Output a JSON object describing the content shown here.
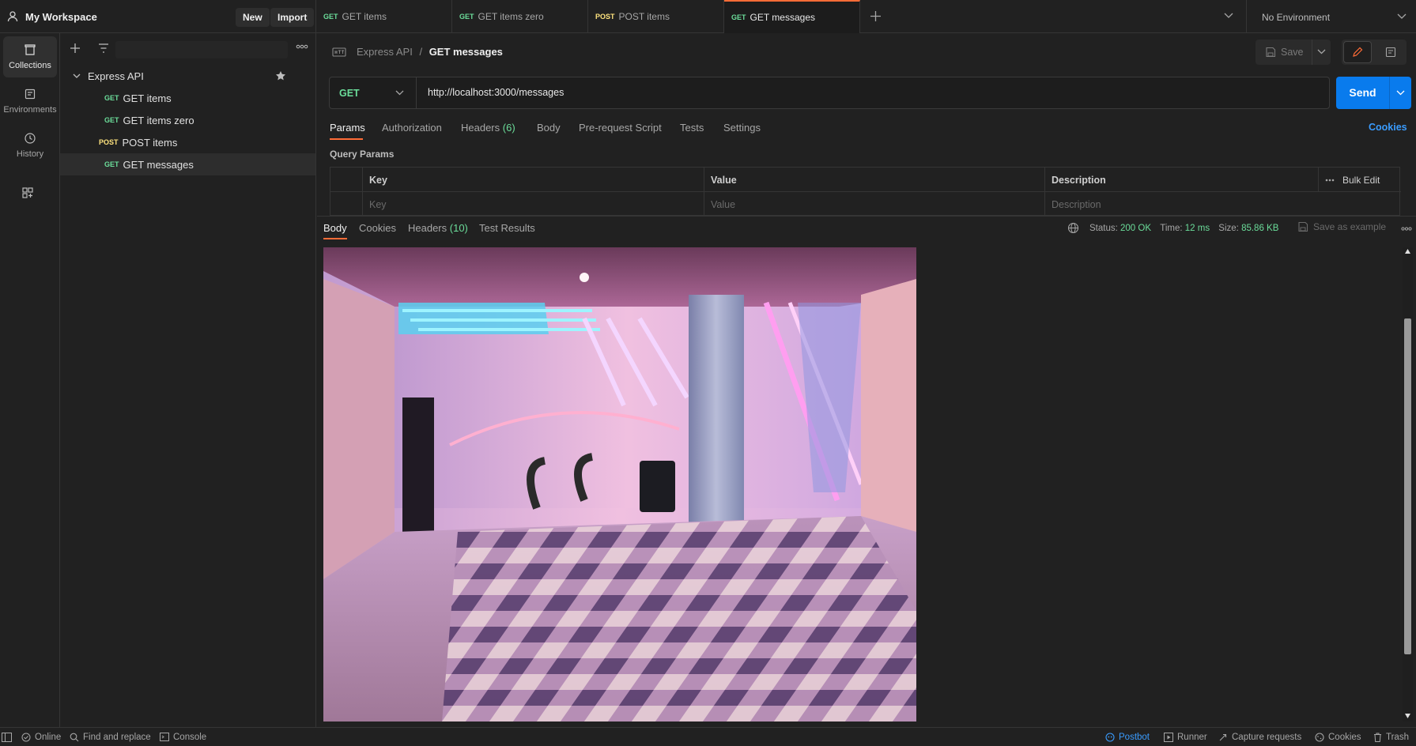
{
  "workspace": {
    "name": "My Workspace",
    "new_label": "New",
    "import_label": "Import"
  },
  "tabs": [
    {
      "method": "GET",
      "label": "GET items"
    },
    {
      "method": "GET",
      "label": "GET items zero"
    },
    {
      "method": "POST",
      "label": "POST items"
    },
    {
      "method": "GET",
      "label": "GET messages"
    }
  ],
  "environment": {
    "selected": "No Environment"
  },
  "rail": [
    {
      "label": "Collections",
      "icon": "collections-icon"
    },
    {
      "label": "Environments",
      "icon": "environments-icon"
    },
    {
      "label": "History",
      "icon": "history-icon"
    },
    {
      "icon": "apps-icon"
    }
  ],
  "collection": {
    "name": "Express API",
    "requests": [
      {
        "method": "GET",
        "label": "GET items"
      },
      {
        "method": "GET",
        "label": "GET items zero"
      },
      {
        "method": "POST",
        "label": "POST items"
      },
      {
        "method": "GET",
        "label": "GET messages"
      }
    ]
  },
  "breadcrumb": {
    "parent": "Express API",
    "separator": "/",
    "current": "GET messages"
  },
  "save_label": "Save",
  "request": {
    "method": "GET",
    "url": "http://localhost:3000/messages",
    "send_label": "Send"
  },
  "request_tabs": {
    "params": "Params",
    "authorization": "Authorization",
    "headers": "Headers",
    "headers_count": "(6)",
    "body": "Body",
    "prerequest": "Pre-request Script",
    "tests": "Tests",
    "settings": "Settings",
    "cookies": "Cookies"
  },
  "query_params": {
    "title": "Query Params",
    "columns": [
      "Key",
      "Value",
      "Description"
    ],
    "placeholders": [
      "Key",
      "Value",
      "Description"
    ],
    "bulk_edit": "Bulk Edit"
  },
  "response_tabs": {
    "body": "Body",
    "cookies": "Cookies",
    "headers": "Headers",
    "headers_count": "(10)",
    "tests": "Test Results"
  },
  "response_status": {
    "status_label": "Status:",
    "status_value": "200 OK",
    "time_label": "Time:",
    "time_value": "12 ms",
    "size_label": "Size:",
    "size_value": "85.86 KB",
    "save_example": "Save as example"
  },
  "statusbar": {
    "online": "Online",
    "find_replace": "Find and replace",
    "console": "Console",
    "postbot": "Postbot",
    "runner": "Runner",
    "capture": "Capture requests",
    "cookies": "Cookies",
    "trash": "Trash"
  },
  "colors": {
    "accent": "#ff6c37",
    "send": "#097bed",
    "get": "#6bdd9a",
    "post": "#ffe47e",
    "link": "#3a9cff"
  }
}
